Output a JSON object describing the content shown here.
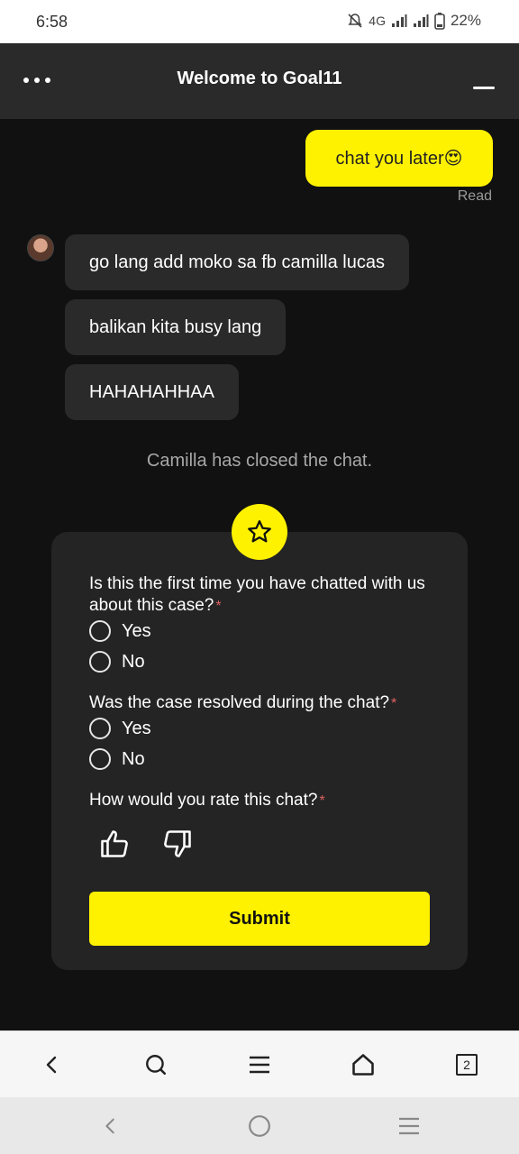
{
  "status_bar": {
    "time": "6:58",
    "network": "4G",
    "battery": "22%"
  },
  "header": {
    "title": "Welcome to Goal11",
    "menu_icon": "more-dots-icon",
    "minimize_icon": "minimize-icon"
  },
  "chat": {
    "outgoing": [
      {
        "text": "chat you later😍",
        "status": "Read"
      }
    ],
    "incoming": [
      {
        "text": "go lang add moko sa fb camilla lucas"
      },
      {
        "text": "balikan kita busy lang"
      },
      {
        "text": "HAHAHAHHAA"
      }
    ],
    "system_message": "Camilla has closed the chat."
  },
  "survey": {
    "badge_icon": "star-icon",
    "questions": [
      {
        "text": "Is this the first time you have chatted with us about this case?",
        "required": "*",
        "options": [
          "Yes",
          "No"
        ]
      },
      {
        "text": "Was the case resolved during the chat?",
        "required": "*",
        "options": [
          "Yes",
          "No"
        ]
      },
      {
        "text": "How would you rate this chat?",
        "required": "*"
      }
    ],
    "rating_icons": [
      "thumbs-up-icon",
      "thumbs-down-icon"
    ],
    "submit_label": "Submit"
  },
  "browser_bar": {
    "tab_count": "2"
  },
  "colors": {
    "accent": "#fff200",
    "background": "#111111",
    "bubble": "#2a2a2a",
    "required": "#e06060"
  }
}
